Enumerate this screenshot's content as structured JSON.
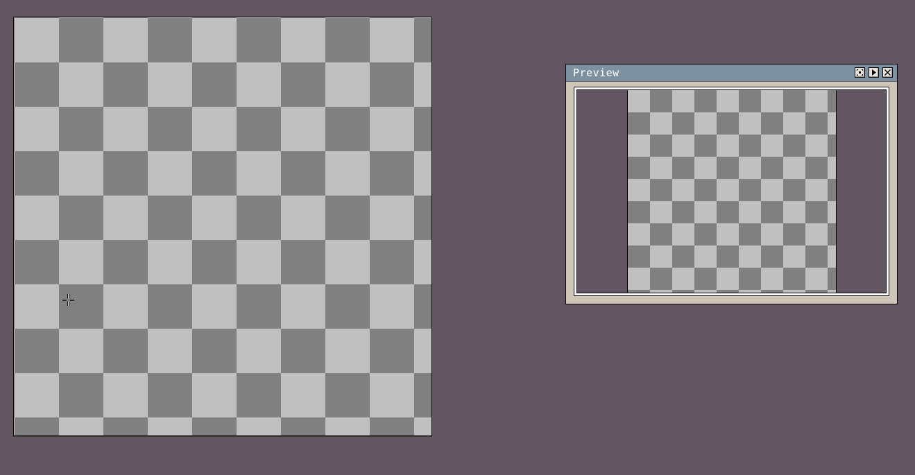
{
  "colors": {
    "workspace": "#645562",
    "checker_light": "#c0c0c0",
    "checker_dark": "#808080",
    "titlebar": "#7d91a0",
    "window_face": "#cfc6b8"
  },
  "canvas": {
    "cursor_icon": "crosshair-cursor-icon"
  },
  "preview": {
    "title": "Preview",
    "buttons": [
      {
        "icon": "fit-view-icon"
      },
      {
        "icon": "play-icon"
      },
      {
        "icon": "close-icon"
      }
    ]
  }
}
